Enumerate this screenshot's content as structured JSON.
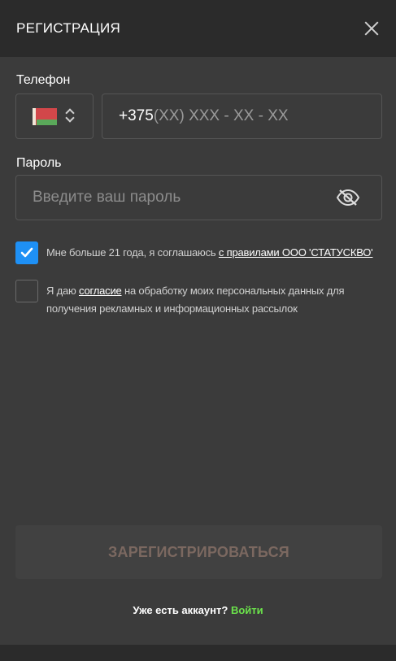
{
  "header": {
    "title": "РЕГИСТРАЦИЯ",
    "close_icon": "close-icon"
  },
  "phone": {
    "label": "Телефон",
    "country_flag": "belarus-flag",
    "code": "+375",
    "mask": "(XX) XXX - XX - XX"
  },
  "password": {
    "label": "Пароль",
    "placeholder": "Введите ваш пароль",
    "visibility_icon": "eye-slash-icon"
  },
  "consent_age": {
    "checked": true,
    "text": "Мне больше 21 года, я соглашаюсь",
    "link": "с правилами ООО 'СТАТУСКВО'"
  },
  "consent_marketing": {
    "checked": false,
    "text_before": "Я даю",
    "link": "согласие",
    "text_after": "на обработку моих персональных данных для получения рекламных и информационных рассылок"
  },
  "submit": {
    "label": "ЗАРЕГИСТРИРОВАТЬСЯ"
  },
  "login": {
    "prompt": "Уже есть аккаунт?",
    "link": "Войти"
  },
  "colors": {
    "accent_blue": "#1e90f5",
    "login_green": "#6be34b",
    "disabled_button_text": "#7b6860"
  }
}
